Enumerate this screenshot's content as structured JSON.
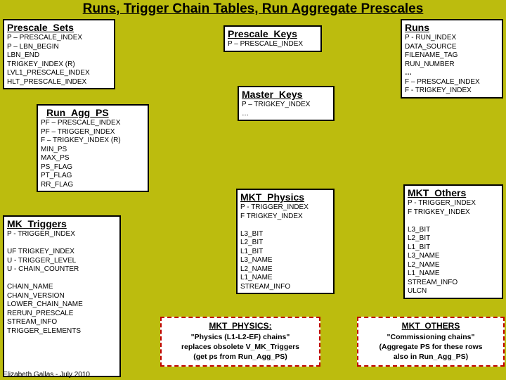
{
  "title": "Runs, Trigger Chain Tables, Run Aggregate Prescales",
  "prescale_sets": {
    "header": "Prescale_Sets",
    "lines": [
      "P – PRESCALE_INDEX",
      "P – LBN_BEGIN",
      "LBN_END",
      "TRIGKEY_INDEX (R)",
      "LVL1_PRESCALE_INDEX",
      "HLT_PRESCALE_INDEX"
    ]
  },
  "prescale_keys": {
    "header": "Prescale_Keys",
    "lines": [
      "P – PRESCALE_INDEX"
    ]
  },
  "runs": {
    "header": "Runs",
    "lines": [
      "P - RUN_INDEX",
      "DATA_SOURCE",
      "FILENAME_TAG",
      "RUN_NUMBER"
    ],
    "ellipsis": "…",
    "lines2": [
      "F – PRESCALE_INDEX",
      "F - TRIGKEY_INDEX"
    ]
  },
  "master_keys": {
    "header": "Master_Keys",
    "lines": [
      "P – TRIGKEY_INDEX",
      "…"
    ]
  },
  "run_agg_ps": {
    "header": "Run_Agg_PS",
    "lines": [
      "PF – PRESCALE_INDEX",
      "PF – TRIGGER_INDEX",
      "F – TRIGKEY_INDEX (R)",
      "MIN_PS",
      "MAX_PS",
      "PS_FLAG",
      "PT_FLAG",
      "RR_FLAG"
    ]
  },
  "mkt_physics": {
    "header": "MKT_Physics",
    "lines": [
      "P - TRIGGER_INDEX",
      "F  TRIGKEY_INDEX",
      "",
      "L3_BIT",
      "L2_BIT",
      "L1_BIT",
      "L3_NAME",
      "L2_NAME",
      "L1_NAME",
      "STREAM_INFO"
    ]
  },
  "mkt_others": {
    "header": "MKT_Others",
    "lines": [
      "P - TRIGGER_INDEX",
      "F  TRIGKEY_INDEX",
      "",
      "L3_BIT",
      "L2_BIT",
      "L1_BIT",
      "L3_NAME",
      "L2_NAME",
      "L1_NAME",
      "STREAM_INFO",
      "ULCN"
    ]
  },
  "mk_triggers": {
    "header": "MK_Triggers",
    "lines": [
      "P - TRIGGER_INDEX",
      "",
      "UF  TRIGKEY_INDEX",
      "U - TRIGGER_LEVEL",
      "U - CHAIN_COUNTER",
      "",
      "CHAIN_NAME",
      "CHAIN_VERSION",
      "LOWER_CHAIN_NAME",
      "RERUN_PRESCALE",
      "STREAM_INFO",
      "TRIGGER_ELEMENTS"
    ]
  },
  "note_physics": {
    "title": "MKT_PHYSICS:",
    "lines": [
      "\"Physics (L1-L2-EF) chains\"",
      "replaces obsolete V_MK_Triggers",
      "(get ps from Run_Agg_PS)"
    ]
  },
  "note_others": {
    "title": "MKT_OTHERS",
    "lines": [
      "\"Commissioning chains\"",
      "(Aggregate PS for these rows",
      "also in Run_Agg_PS)"
    ]
  },
  "footer": "Elizabeth Gallas - July 2010"
}
